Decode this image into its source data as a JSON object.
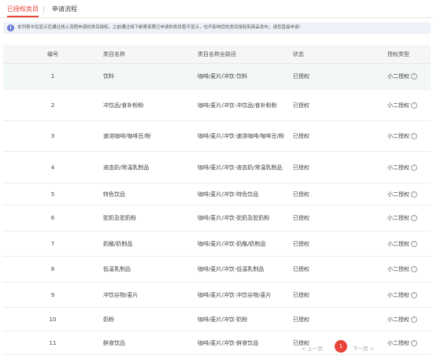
{
  "tabs": [
    {
      "label": "已授权类目",
      "active": true
    },
    {
      "label": "申请流程",
      "active": false
    }
  ],
  "tab_separator": "|",
  "notice": {
    "icon": "info-icon",
    "text": "本列表中仅显示您通过线上流程申请的类目授权，之前通过线下邮寄资质已申请的类目暂不显示，也不影响您的类目授权和商品发布，请您直接申请!"
  },
  "table": {
    "columns": [
      "编号",
      "类目名称",
      "类目名称全路径",
      "状态",
      "授权类型"
    ],
    "rows": [
      {
        "no": "1",
        "name": "饮料",
        "path": "咖啡/麦片/冲饮-饮料",
        "status": "已授权",
        "type": "小二授权"
      },
      {
        "no": "2",
        "name": "冲饮品/食补粉粉",
        "path": "咖啡/麦片/冲饮-冲饮品/食补粉粉",
        "status": "已授权",
        "type": "小二授权"
      },
      {
        "no": "3",
        "name": "速溶咖啡/咖啡豆/粉",
        "path": "咖啡/麦片/冲饮-速溶咖啡/咖啡豆/粉",
        "status": "已授权",
        "type": "小二授权"
      },
      {
        "no": "4",
        "name": "液态奶/常温乳制品",
        "path": "咖啡/麦片/冲饮-液态奶/常温乳制品",
        "status": "已授权",
        "type": "小二授权"
      },
      {
        "no": "5",
        "name": "特色饮品",
        "path": "咖啡/麦片/冲饮-特色饮品",
        "status": "已授权",
        "type": "小二授权"
      },
      {
        "no": "6",
        "name": "驼奶及驼奶粉",
        "path": "咖啡/麦片/冲饮-驼奶及驼奶粉",
        "status": "已授权",
        "type": "小二授权"
      },
      {
        "no": "7",
        "name": "奶酪/奶制品",
        "path": "咖啡/麦片/冲饮-奶酪/奶制品",
        "status": "已授权",
        "type": "小二授权"
      },
      {
        "no": "8",
        "name": "低温乳制品",
        "path": "咖啡/麦片/冲饮-低温乳制品",
        "status": "已授权",
        "type": "小二授权"
      },
      {
        "no": "9",
        "name": "冲饮谷物/麦片",
        "path": "咖啡/麦片/冲饮-冲饮谷物/麦片",
        "status": "已授权",
        "type": "小二授权"
      },
      {
        "no": "10",
        "name": "奶粉",
        "path": "咖啡/麦片/冲饮-奶粉",
        "status": "已授权",
        "type": "小二授权"
      },
      {
        "no": "11",
        "name": "鲜食饮品",
        "path": "咖啡/麦片/冲饮-鲜食饮品",
        "status": "已授权",
        "type": "小二授权"
      }
    ],
    "help_icon": "question-circle-icon"
  },
  "pagination": {
    "prev": "< 上一页",
    "current": "1",
    "next": "下一页 >"
  },
  "colors": {
    "accent": "#e8443a",
    "info": "#6a7cd6",
    "highlight_row": "#f2f8f6"
  }
}
